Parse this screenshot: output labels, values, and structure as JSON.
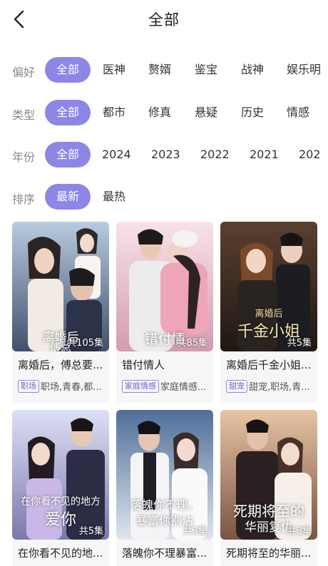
{
  "header": {
    "title": "全部"
  },
  "filters": [
    {
      "label": "偏好",
      "options": [
        "全部",
        "医神",
        "赘婿",
        "鉴宝",
        "战神",
        "娱乐明"
      ]
    },
    {
      "label": "类型",
      "options": [
        "全部",
        "都市",
        "修真",
        "悬疑",
        "历史",
        "情感"
      ]
    },
    {
      "label": "年份",
      "options": [
        "全部",
        "2024",
        "2023",
        "2022",
        "2021",
        "202"
      ]
    },
    {
      "label": "排序",
      "options": [
        "最新",
        "最热"
      ]
    }
  ],
  "dramas": [
    {
      "title": "离婚后，傅总要...",
      "episodes": "共105集",
      "tag": "职场",
      "subtags": "职场,青春,都...",
      "poster_text": "离婚后",
      "poster_text2": "傅总",
      "colors": [
        "#9fb6d2",
        "#3d4b66"
      ]
    },
    {
      "title": "错付情人",
      "episodes": "共85集",
      "tag": "家庭情感",
      "subtags": "家庭情感...",
      "poster_text": "错付情",
      "poster_text2": "",
      "colors": [
        "#f3d2dc",
        "#c98aa0"
      ]
    },
    {
      "title": "离婚后千金小姐...",
      "episodes": "共5集",
      "tag": "甜宠",
      "subtags": "甜宠,职场,青...",
      "poster_text": "千金小姐",
      "poster_text2": "离婚后",
      "colors": [
        "#3a2a22",
        "#b48a5a"
      ]
    },
    {
      "title": "在你看不见的地...",
      "episodes": "共5集",
      "tag": "",
      "subtags": "",
      "poster_text": "在你看不见的地方",
      "poster_text2": "爱你",
      "colors": [
        "#cfd3f0",
        "#6c6a9e"
      ]
    },
    {
      "title": "落魄你不理暴富...",
      "episodes": "共3集",
      "tag": "",
      "subtags": "",
      "poster_text": "落魄你不理，",
      "poster_text2": "暴富你别沾",
      "colors": [
        "#5d7fa8",
        "#e8eef5"
      ]
    },
    {
      "title": "死期将至的华丽...",
      "episodes": "共3集",
      "tag": "",
      "subtags": "",
      "poster_text": "死期将至的",
      "poster_text2": "华丽复仇",
      "colors": [
        "#d9b392",
        "#6e4a3a"
      ]
    }
  ]
}
